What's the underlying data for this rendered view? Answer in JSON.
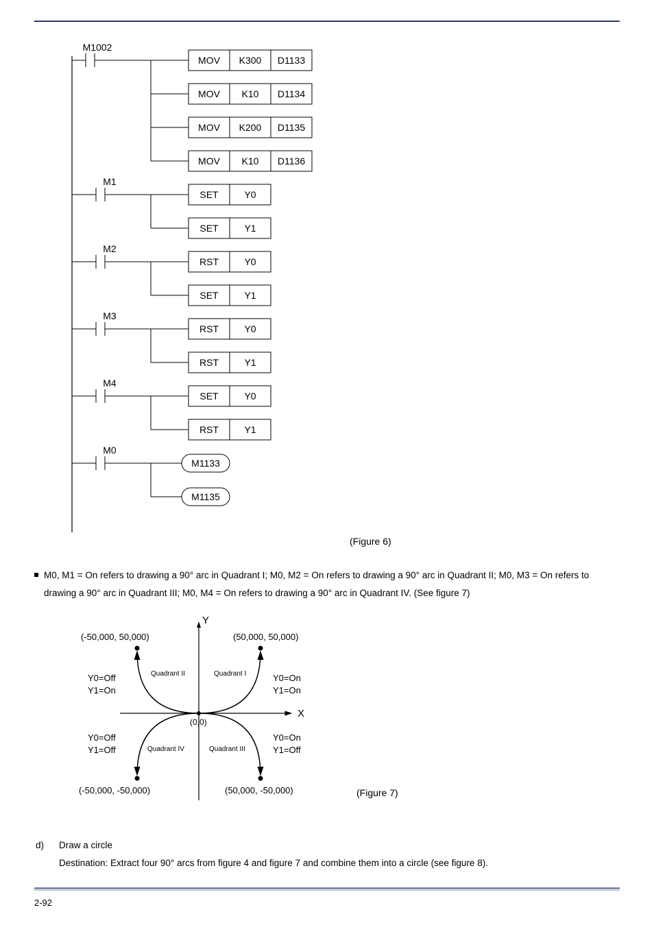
{
  "ladder": {
    "rails": [
      {
        "contact": "M1002",
        "rows": [
          {
            "op": "MOV",
            "a": "K300",
            "b": "D1133"
          },
          {
            "op": "MOV",
            "a": "K10",
            "b": "D1134"
          },
          {
            "op": "MOV",
            "a": "K200",
            "b": "D1135"
          },
          {
            "op": "MOV",
            "a": "K10",
            "b": "D1136"
          }
        ]
      },
      {
        "contact": "M1",
        "rows": [
          {
            "op": "SET",
            "a": "Y0"
          },
          {
            "op": "SET",
            "a": "Y1"
          }
        ]
      },
      {
        "contact": "M2",
        "rows": [
          {
            "op": "RST",
            "a": "Y0"
          },
          {
            "op": "SET",
            "a": "Y1"
          }
        ]
      },
      {
        "contact": "M3",
        "rows": [
          {
            "op": "RST",
            "a": "Y0"
          },
          {
            "op": "RST",
            "a": "Y1"
          }
        ]
      },
      {
        "contact": "M4",
        "rows": [
          {
            "op": "SET",
            "a": "Y0"
          },
          {
            "op": "RST",
            "a": "Y1"
          }
        ]
      },
      {
        "contact": "M0",
        "coils": [
          "M1133",
          "M1135"
        ]
      }
    ]
  },
  "fig6_caption": "(Figure 6)",
  "bullet_text": "M0, M1 = On refers to drawing a 90° arc in Quadrant I; M0, M2 = On refers to drawing a 90° arc in Quadrant II; M0, M3 = On refers to drawing a 90° arc in Quadrant III; M0, M4 = On refers to drawing a 90° arc in Quadrant IV. (See figure 7)",
  "quad": {
    "axis_y": "Y",
    "axis_x": "X",
    "origin": "(0,0)",
    "pts": {
      "tl": "(-50,000, 50,000)",
      "tr": "(50,000, 50,000)",
      "bl": "(-50,000, -50,000)",
      "br": "(50,000, -50,000)"
    },
    "labels": {
      "q1": "Quadrant I",
      "q2": "Quadrant II",
      "q3": "Quadrant III",
      "q4": "Quadrant IV"
    },
    "states": {
      "q1a": "Y0=On",
      "q1b": "Y1=On",
      "q2a": "Y0=Off",
      "q2b": "Y1=On",
      "q3a": "Y0=On",
      "q3b": "Y1=Off",
      "q4a": "Y0=Off",
      "q4b": "Y1=Off"
    }
  },
  "fig7_caption": "(Figure 7)",
  "section_d": {
    "label": "d)",
    "title": "Draw a circle",
    "desc": "Destination: Extract four 90° arcs from figure 4 and figure 7 and combine them into a circle (see figure 8)."
  },
  "page": "2-92"
}
